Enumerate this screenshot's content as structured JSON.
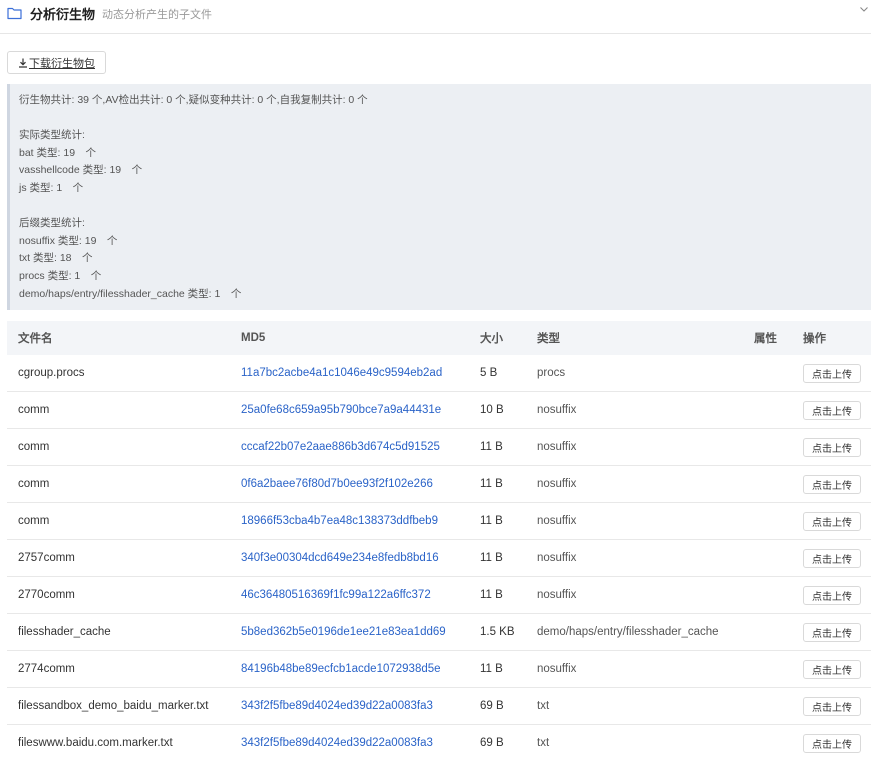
{
  "header": {
    "title": "分析衍生物",
    "subtitle": "动态分析产生的子文件"
  },
  "toolbar": {
    "download_label": "下载衍生物包"
  },
  "stats": {
    "summary": "衍生物共计: 39 个,AV检出共计: 0 个,疑似变种共计: 0 个,自我复制共计: 0 个",
    "actual_heading": "实际类型统计:",
    "actual_items": [
      "bat 类型: 19　个",
      "vasshellcode 类型: 19　个",
      "js 类型: 1　个"
    ],
    "suffix_heading": "后缀类型统计:",
    "suffix_items": [
      "nosuffix 类型: 19　个",
      "txt 类型: 18　个",
      "procs 类型: 1　个",
      "demo/haps/entry/filesshader_cache 类型: 1　个"
    ]
  },
  "table": {
    "columns": {
      "name": "文件名",
      "md5": "MD5",
      "size": "大小",
      "type": "类型",
      "attr": "属性",
      "op": "操作"
    },
    "upload_label": "点击上传",
    "rows": [
      {
        "name": "cgroup.procs",
        "md5": "11a7bc2acbe4a1c1046e49c9594eb2ad",
        "size": "5 B",
        "type": "procs"
      },
      {
        "name": "comm",
        "md5": "25a0fe68c659a95b790bce7a9a44431e",
        "size": "10 B",
        "type": "nosuffix"
      },
      {
        "name": "comm",
        "md5": "cccaf22b07e2aae886b3d674c5d91525",
        "size": "11 B",
        "type": "nosuffix"
      },
      {
        "name": "comm",
        "md5": "0f6a2baee76f80d7b0ee93f2f102e266",
        "size": "11 B",
        "type": "nosuffix"
      },
      {
        "name": "comm",
        "md5": "18966f53cba4b7ea48c138373ddfbeb9",
        "size": "11 B",
        "type": "nosuffix"
      },
      {
        "name": "2757comm",
        "md5": "340f3e00304dcd649e234e8fedb8bd16",
        "size": "11 B",
        "type": "nosuffix"
      },
      {
        "name": "2770comm",
        "md5": "46c36480516369f1fc99a122a6ffc372",
        "size": "11 B",
        "type": "nosuffix"
      },
      {
        "name": "filesshader_cache",
        "md5": "5b8ed362b5e0196de1ee21e83ea1dd69",
        "size": "1.5 KB",
        "type": "demo/haps/entry/filesshader_cache"
      },
      {
        "name": "2774comm",
        "md5": "84196b48be89ecfcb1acde1072938d5e",
        "size": "11 B",
        "type": "nosuffix"
      },
      {
        "name": "filessandbox_demo_baidu_marker.txt",
        "md5": "343f2f5fbe89d4024ed39d22a0083fa3",
        "size": "69 B",
        "type": "txt"
      },
      {
        "name": "fileswww.baidu.com.marker.txt",
        "md5": "343f2f5fbe89d4024ed39d22a0083fa3",
        "size": "69 B",
        "type": "txt"
      }
    ]
  }
}
